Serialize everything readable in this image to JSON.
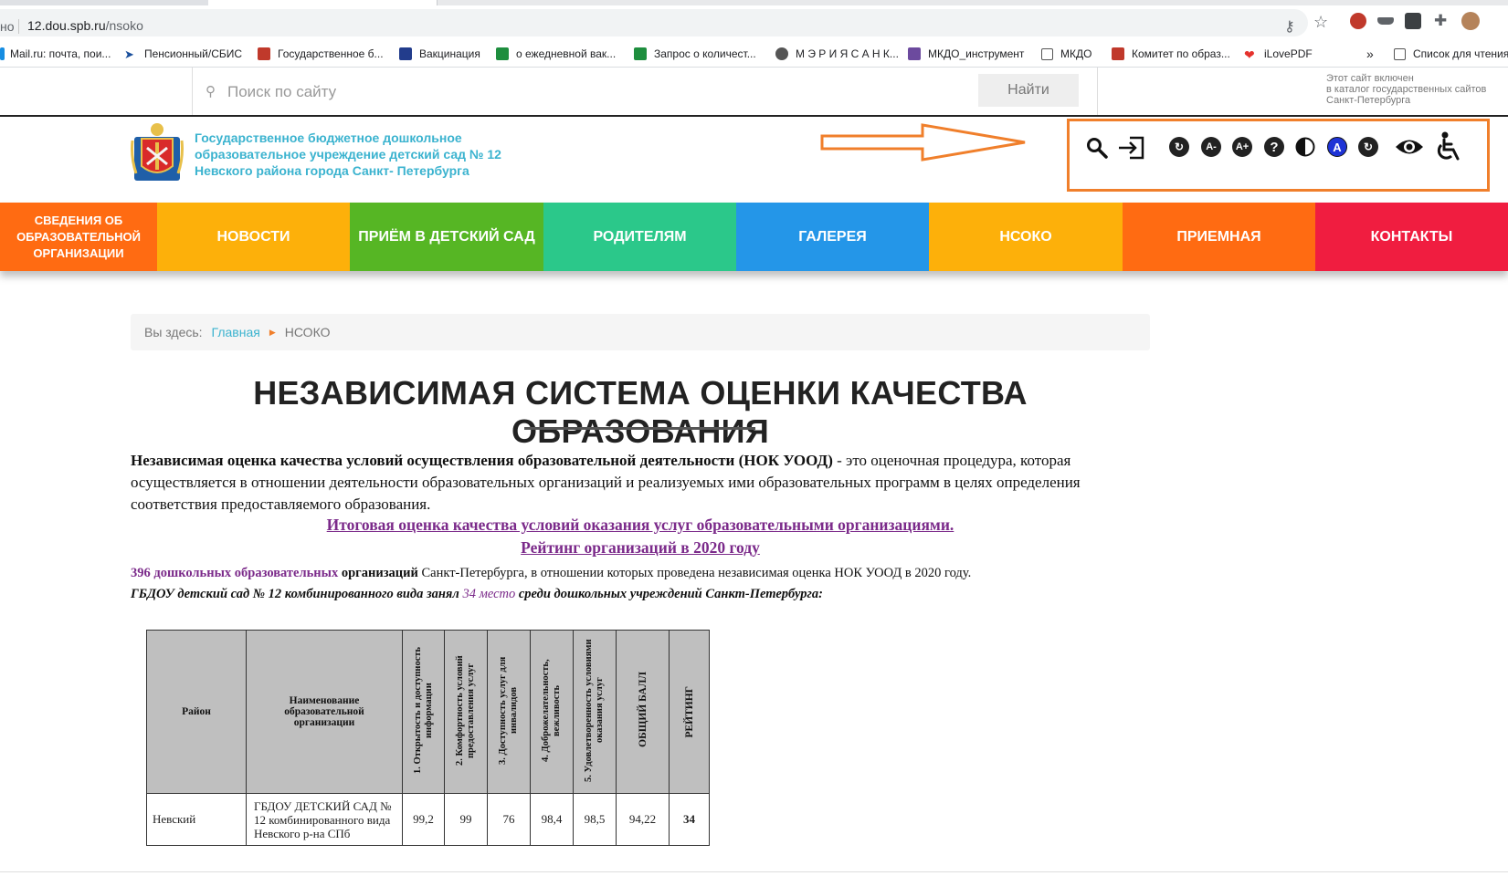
{
  "browser": {
    "url_prefix": "но",
    "url_host": "12.dou.spb.ru",
    "url_path": "/nsoko",
    "bookmarks": [
      "Mail.ru: почта, пои...",
      "Пенсионный/СБИС",
      "Государственное б...",
      "Вакцинация",
      "о ежедневной вак...",
      "Запрос о количест...",
      "М Э Р И Я С А Н К...",
      "МКДО_инструмент",
      "МКДО",
      "Комитет по образ...",
      "iLovePDF"
    ],
    "overflow": "»",
    "reading_list": "Список для чтения"
  },
  "site": {
    "search_placeholder": "Поиск по сайту",
    "search_button": "Найти",
    "catalog_note": [
      "Этот сайт включен",
      "в каталог государственных сайтов",
      "Санкт-Петербурга"
    ],
    "org_name": [
      "Государственное бюджетное дошкольное",
      "образовательное учреждение детский сад № 12",
      "Невского района города Санкт- Петербурга"
    ]
  },
  "a11y_icons": [
    "search-icon",
    "login-icon",
    "reset-icon",
    "font-decrease-icon",
    "font-increase-icon",
    "help-icon",
    "contrast-icon",
    "color-scheme-icon",
    "refresh-icon",
    "eye-icon",
    "wheelchair-icon"
  ],
  "colors": {
    "nav": [
      "#ff6b12",
      "#fdb00a",
      "#56b624",
      "#2bc88a",
      "#2496e8",
      "#fdb00a",
      "#ff6b12",
      "#f01d40"
    ],
    "accent_orange": "#f07f2b",
    "org_name": "#3bb3cf",
    "link_purple": "#7b2a8a"
  },
  "nav": [
    "СВЕДЕНИЯ ОБ ОБРАЗОВАТЕЛЬНОЙ ОРГАНИЗАЦИИ",
    "НОВОСТИ",
    "ПРИЁМ В ДЕТСКИЙ САД",
    "РОДИТЕЛЯМ",
    "ГАЛЕРЕЯ",
    "НСОКО",
    "ПРИЕМНАЯ",
    "КОНТАКТЫ"
  ],
  "breadcrumb": {
    "prefix": "Вы здесь:",
    "home": "Главная",
    "current": "НСОКО"
  },
  "page_title": "НЕЗАВИСИМАЯ СИСТЕМА ОЦЕНКИ КАЧЕСТВА ОБРАЗОВАНИЯ",
  "intro": {
    "bold": "Независимая оценка качества условий осуществления образовательной деятельности (НОК УООД)",
    "rest": " - это оценочная процедура, которая осуществляется в отношении деятельности образовательных организаций и реализуемых ими образовательных программ в целях определения соответствия предоставляемого образования."
  },
  "links": {
    "final_rating": "Итоговая оценка качества условий оказания услуг образовательными организациями.",
    "rating_2020": "Рейтинг организаций в 2020 году"
  },
  "stats": {
    "count": "396 дошкольных образовательных",
    "org_word": " организаций",
    "tail": " Санкт-Петербурга, в отношении которых проведена независимая оценка НОК УООД в 2020 году."
  },
  "place": {
    "before": "ГБДОУ детский сад № 12 комбинированного вида занял ",
    "place": "34 место",
    "after": " среди дошкольных учреждений Санкт-Петербурга:"
  },
  "table": {
    "headers": [
      "Район",
      "Наименование образовательной организации",
      "1. Открытость и доступность информации",
      "2. Комфортность условий предоставления услуг",
      "3. Доступность услуг для инвалидов",
      "4. Доброжелательность, вежливость",
      "5. Удовлетворенность условиями оказания услуг",
      "ОБЩИЙ БАЛЛ",
      "РЕЙТИНГ"
    ],
    "row": {
      "district": "Невский",
      "org": "ГБДОУ ДЕТСКИЙ САД № 12 комбинированного вида Невского р-на СПб",
      "c1": "99,2",
      "c2": "99",
      "c3": "76",
      "c4": "98,4",
      "c5": "98,5",
      "total": "94,22",
      "rank": "34"
    }
  }
}
